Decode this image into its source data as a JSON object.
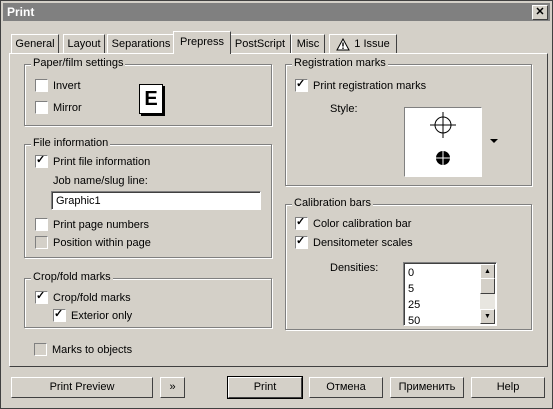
{
  "window": {
    "title": "Print",
    "close_glyph": "✕"
  },
  "tabs": [
    {
      "label": "General"
    },
    {
      "label": "Layout"
    },
    {
      "label": "Separations"
    },
    {
      "label": "Prepress"
    },
    {
      "label": "PostScript"
    },
    {
      "label": "Misc"
    },
    {
      "label": "1 Issue",
      "icon": "warning-icon"
    }
  ],
  "active_tab": "Prepress",
  "paper_film": {
    "title": "Paper/film settings",
    "invert": {
      "label": "Invert",
      "checked": false
    },
    "mirror": {
      "label": "Mirror",
      "checked": false
    },
    "preview_glyph": "E"
  },
  "file_info": {
    "title": "File information",
    "print_file_info": {
      "label": "Print file information",
      "checked": true
    },
    "job_label": "Job name/slug line:",
    "job_value": "Graphic1",
    "print_page_numbers": {
      "label": "Print page numbers",
      "checked": false
    },
    "position_within_page": {
      "label": "Position within page",
      "checked": false,
      "disabled": true
    }
  },
  "crop_fold": {
    "title": "Crop/fold marks",
    "crop_marks": {
      "label": "Crop/fold marks",
      "checked": true
    },
    "exterior_only": {
      "label": "Exterior only",
      "checked": true
    }
  },
  "marks_to_objects": {
    "label": "Marks to objects",
    "checked": false,
    "disabled": true
  },
  "registration": {
    "title": "Registration marks",
    "print_reg_marks": {
      "label": "Print registration marks",
      "checked": true
    },
    "style_label": "Style:"
  },
  "calibration": {
    "title": "Calibration bars",
    "color_bar": {
      "label": "Color calibration bar",
      "checked": true
    },
    "densitometer": {
      "label": "Densitometer scales",
      "checked": true
    },
    "densities_label": "Densities:",
    "densities": [
      "0",
      "5",
      "25",
      "50"
    ]
  },
  "buttons": {
    "print_preview": "Print Preview",
    "expand_glyph": "»",
    "print": "Print",
    "cancel": "Отмена",
    "apply": "Применить",
    "help": "Help"
  },
  "colors": {
    "titlebar": "#808080",
    "face": "#d4d0c8"
  }
}
